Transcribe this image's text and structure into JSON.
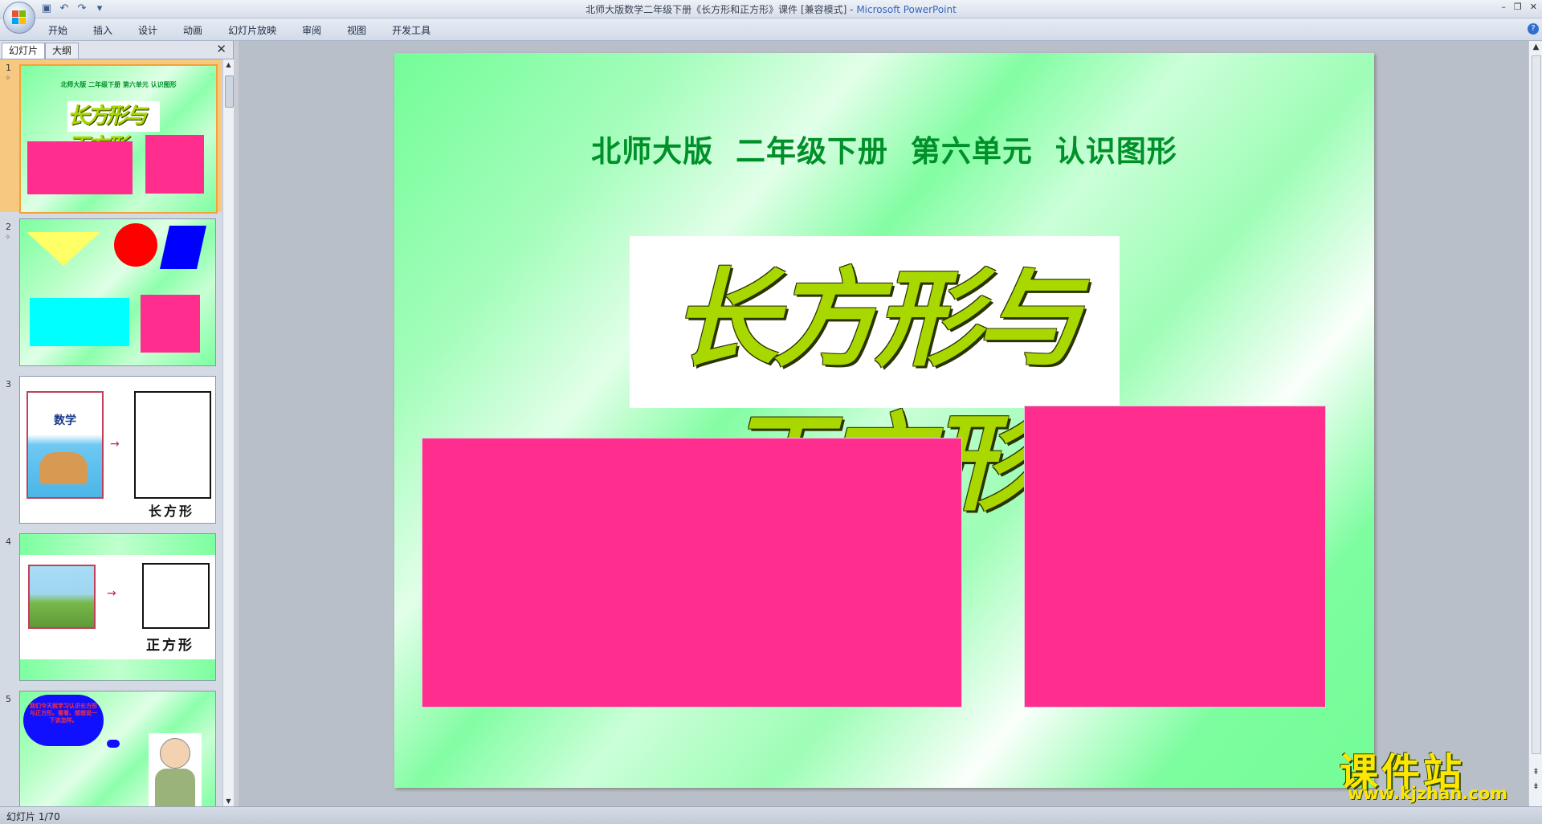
{
  "window": {
    "title": "北师大版数学二年级下册《长方形和正方形》课件 [兼容模式] - ",
    "app_name": "Microsoft PowerPoint",
    "controls": [
      "–",
      "❐",
      "✕"
    ]
  },
  "quick_access": [
    "save-icon",
    "undo-icon",
    "redo-icon",
    "customize-icon"
  ],
  "ribbon": {
    "tabs": [
      "开始",
      "插入",
      "设计",
      "动画",
      "幻灯片放映",
      "审阅",
      "视图",
      "开发工具"
    ],
    "help_label": "?"
  },
  "panel": {
    "tab_slides": "幻灯片",
    "tab_outline": "大纲",
    "close_label": "✕",
    "thumbnails": [
      {
        "num": "1",
        "subtitle": "北师大版  二年级下册  第六单元  认识图形",
        "art": "长方形与正方形"
      },
      {
        "num": "2"
      },
      {
        "num": "3",
        "book_title": "数学",
        "caption": "长方形"
      },
      {
        "num": "4",
        "caption": "正方形"
      },
      {
        "num": "5",
        "cloud_text": "我们今天就学习认识长方形与正方形。看看、想想说一下该怎样。"
      }
    ]
  },
  "slide": {
    "subtitle": "北师大版  二年级下册  第六单元  认识图形",
    "art_title": "长方形与正方形"
  },
  "status": {
    "slide_counter": "幻灯片 1/70"
  },
  "watermark": {
    "big": "课件站",
    "small": "www.kjzhan.com"
  },
  "colors": {
    "pink": "#ff2d8e",
    "green_title": "#00902a",
    "art_fill": "#a9d800"
  }
}
